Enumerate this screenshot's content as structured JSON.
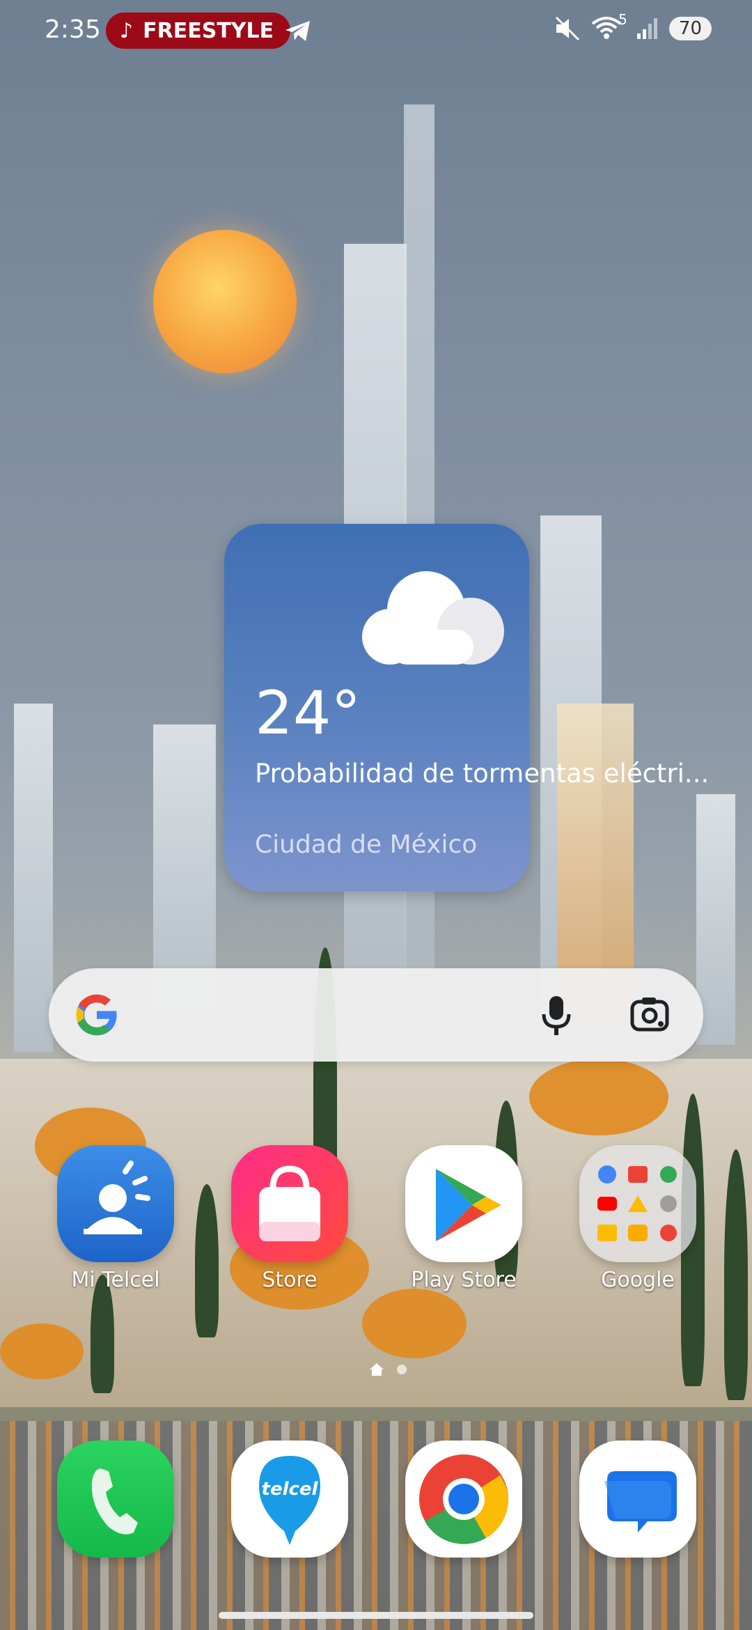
{
  "status_bar": {
    "time": "2:35",
    "media_pill": "FREESTYLE",
    "network_badge": "5",
    "battery": "70"
  },
  "weather": {
    "temperature": "24°",
    "condition": "Probabilidad de tormentas eléctri...",
    "city": "Ciudad de México"
  },
  "apps": [
    {
      "label": "Mi Telcel"
    },
    {
      "label": "Store"
    },
    {
      "label": "Play Store"
    },
    {
      "label": "Google"
    }
  ],
  "page_indicator": {
    "pages": 2,
    "current": 1
  },
  "dock": [
    {
      "icon": "phone-icon"
    },
    {
      "icon": "telcel-icon",
      "text": "telcel"
    },
    {
      "icon": "chrome-icon"
    },
    {
      "icon": "messages-icon"
    }
  ]
}
